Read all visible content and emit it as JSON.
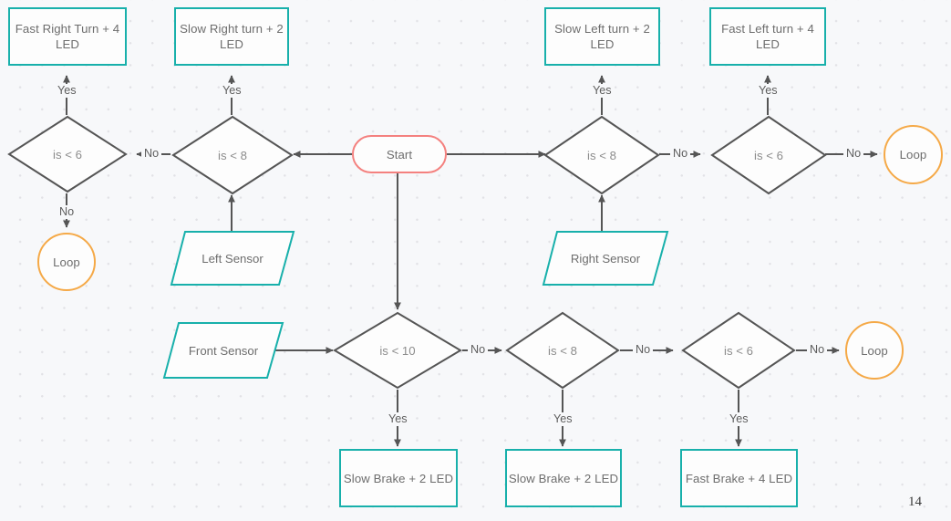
{
  "page": {
    "number": "14",
    "background": "#f7f8fa",
    "colors": {
      "process_border": "#18b0ab",
      "terminator_border": "#f4817f",
      "loop_border": "#f5a947",
      "connector": "#555555",
      "text": "#6d6d6d"
    }
  },
  "nodes": {
    "fast_right_turn": {
      "label": "Fast Right Turn + 4 LED",
      "type": "process"
    },
    "slow_right_turn": {
      "label": "Slow Right turn + 2 LED",
      "type": "process"
    },
    "slow_left_turn": {
      "label": "Slow Left turn + 2 LED",
      "type": "process"
    },
    "fast_left_turn": {
      "label": "Fast Left turn + 4 LED",
      "type": "process"
    },
    "start": {
      "label": "Start",
      "type": "terminator"
    },
    "dec_left_6": {
      "label": "is < 6",
      "type": "decision"
    },
    "dec_left_8": {
      "label": "is < 8",
      "type": "decision"
    },
    "dec_right_8": {
      "label": "is < 8",
      "type": "decision"
    },
    "dec_right_6": {
      "label": "is < 6",
      "type": "decision"
    },
    "loop_left": {
      "label": "Loop",
      "type": "loop"
    },
    "loop_right": {
      "label": "Loop",
      "type": "loop"
    },
    "loop_bottom": {
      "label": "Loop",
      "type": "loop"
    },
    "left_sensor": {
      "label": "Left Sensor",
      "type": "io"
    },
    "right_sensor": {
      "label": "Right Sensor",
      "type": "io"
    },
    "front_sensor": {
      "label": "Front Sensor",
      "type": "io"
    },
    "dec_front_10": {
      "label": "is < 10",
      "type": "decision"
    },
    "dec_front_8": {
      "label": "is < 8",
      "type": "decision"
    },
    "dec_front_6": {
      "label": "is < 6",
      "type": "decision"
    },
    "slow_brake_a": {
      "label": "Slow Brake + 2 LED",
      "type": "process"
    },
    "slow_brake_b": {
      "label": "Slow Brake + 2 LED",
      "type": "process"
    },
    "fast_brake": {
      "label": "Fast Brake + 4 LED",
      "type": "process"
    }
  },
  "edge_labels": {
    "yes_fast_right": "Yes",
    "yes_slow_right": "Yes",
    "yes_slow_left": "Yes",
    "yes_fast_left": "Yes",
    "no_left_8_to_6": "No",
    "no_left_6_to_loop": "No",
    "no_right_8_to_6": "No",
    "no_right_6_to_loop": "No",
    "no_front_10_to_8": "No",
    "no_front_8_to_6": "No",
    "no_front_6_to_loop": "No",
    "yes_front_10": "Yes",
    "yes_front_8": "Yes",
    "yes_front_6": "Yes"
  }
}
